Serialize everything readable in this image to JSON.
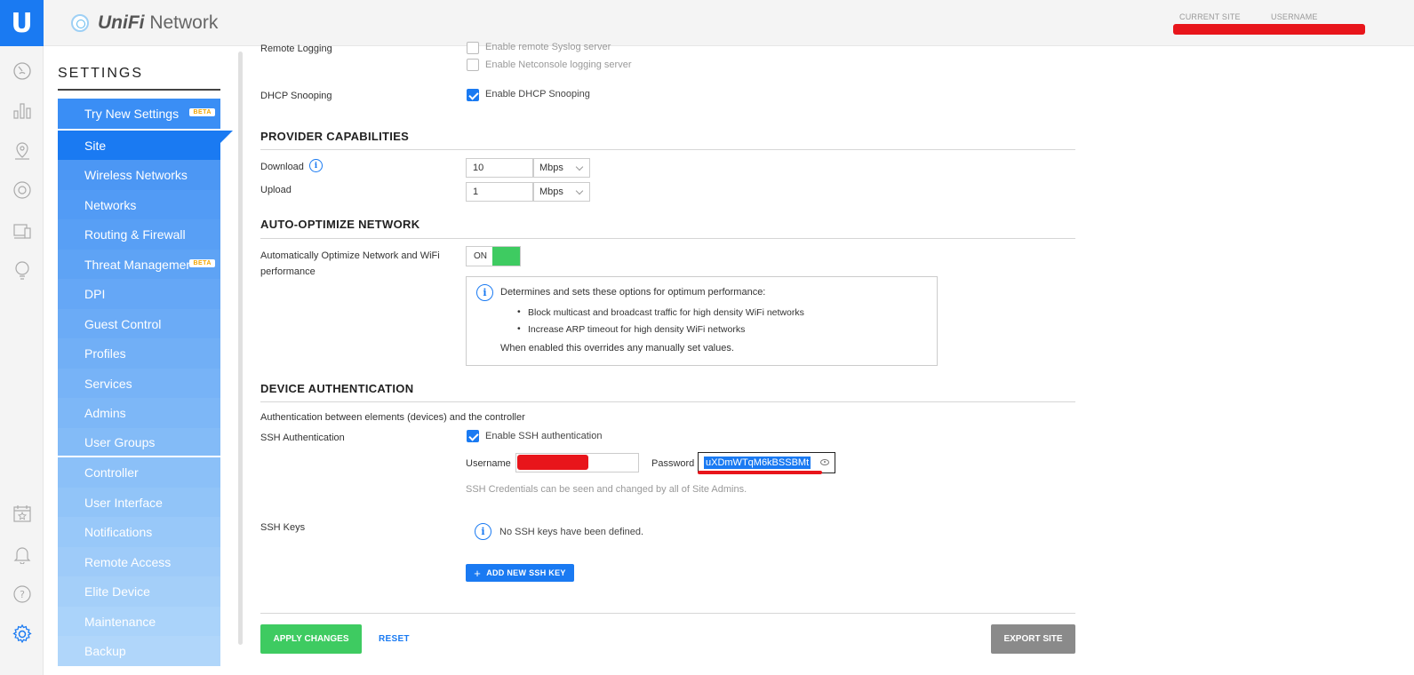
{
  "app": {
    "logo_letter": "U",
    "brand_bold": "UniFi",
    "brand_rest": " Network"
  },
  "top": {
    "current_site_label": "CURRENT SITE",
    "username_label": "USERNAME"
  },
  "sidebar": {
    "title": "SETTINGS",
    "items": [
      {
        "label": "Try New Settings",
        "badge": "BETA",
        "color": "#3a8ef5"
      },
      {
        "label": "Site",
        "color": "#1a7af2",
        "active": true
      },
      {
        "label": "Wireless Networks",
        "color": "#4c97f4"
      },
      {
        "label": "Networks",
        "color": "#529bf5"
      },
      {
        "label": "Routing & Firewall",
        "color": "#589ff5"
      },
      {
        "label": "Threat Management",
        "badge": "BETA",
        "color": "#5ea3f5"
      },
      {
        "label": "DPI",
        "color": "#65a7f6"
      },
      {
        "label": "Guest Control",
        "color": "#6babf6"
      },
      {
        "label": "Profiles",
        "color": "#71aff6"
      },
      {
        "label": "Services",
        "color": "#77b3f7"
      },
      {
        "label": "Admins",
        "color": "#7db7f7"
      },
      {
        "label": "User Groups",
        "color": "#83bbf7"
      },
      {
        "label": "Controller",
        "color": "#8bc0f8"
      },
      {
        "label": "User Interface",
        "color": "#91c4f8"
      },
      {
        "label": "Notifications",
        "color": "#98c8f9"
      },
      {
        "label": "Remote Access",
        "color": "#9ecbf9"
      },
      {
        "label": "Elite Device",
        "color": "#a4cff9"
      },
      {
        "label": "Maintenance",
        "color": "#aad3fa"
      },
      {
        "label": "Backup",
        "color": "#b0d6fa"
      }
    ]
  },
  "remote_logging": {
    "label": "Remote Logging",
    "opt1": "Enable remote Syslog server",
    "opt2": "Enable Netconsole logging server"
  },
  "dhcp": {
    "label": "DHCP Snooping",
    "opt": "Enable DHCP Snooping"
  },
  "provider": {
    "title": "PROVIDER CAPABILITIES",
    "download_label": "Download",
    "download_value": "10",
    "upload_label": "Upload",
    "upload_value": "1",
    "unit": "Mbps"
  },
  "auto_opt": {
    "title": "AUTO-OPTIMIZE NETWORK",
    "label_line1": "Automatically Optimize Network and WiFi",
    "label_line2": "performance",
    "toggle": "ON",
    "info_title": "Determines and sets these options for optimum performance:",
    "bullet1": "Block multicast and broadcast traffic for high density WiFi networks",
    "bullet2": "Increase ARP timeout for high density WiFi networks",
    "info_footer": "When enabled this overrides any manually set values."
  },
  "device_auth": {
    "title": "DEVICE AUTHENTICATION",
    "desc": "Authentication between elements (devices) and the controller",
    "ssh_label": "SSH Authentication",
    "ssh_opt": "Enable SSH authentication",
    "username_label": "Username",
    "password_label": "Password",
    "password_value": "uXDmWTqM6kBSSBMt",
    "creds_note": "SSH Credentials can be seen and changed by all of Site Admins.",
    "keys_label": "SSH Keys",
    "keys_empty": "No SSH keys have been defined.",
    "add_key": "ADD NEW SSH KEY"
  },
  "footer": {
    "apply": "APPLY CHANGES",
    "reset": "RESET",
    "export": "EXPORT SITE"
  },
  "colors": {
    "accent": "#1a7af2",
    "success": "#3ecb61",
    "redaction": "#e8151b"
  }
}
